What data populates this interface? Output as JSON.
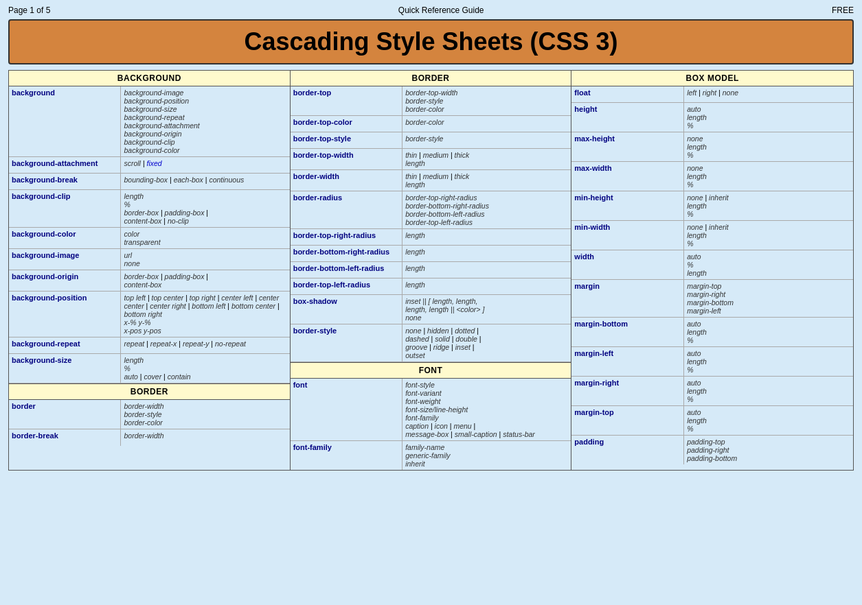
{
  "header": {
    "page_info": "Page 1 of 5",
    "title": "Quick Reference Guide",
    "price": "FREE"
  },
  "main_title": "Cascading Style Sheets (CSS 3)",
  "columns": [
    {
      "id": "background-col",
      "sections": [
        {
          "header": "BACKGROUND",
          "rows": [
            {
              "name": "background",
              "values": "background-image\nbackground-position\nbackground-size\nbackground-repeat\nbackground-attachment\nbackground-origin\nbackground-clip\nbackground-color"
            },
            {
              "name": "background-attachment",
              "values": "scroll | fixed"
            },
            {
              "name": "background-break",
              "values": "bounding-box | each-box | continuous"
            },
            {
              "name": "background-clip",
              "values": "length\n%\nborder-box | padding-box | content-box | no-clip"
            },
            {
              "name": "background-color",
              "values": "color\ntransparent"
            },
            {
              "name": "background-image",
              "values": "url\nnone"
            },
            {
              "name": "background-origin",
              "values": "border-box | padding-box | content-box"
            },
            {
              "name": "background-position",
              "values": "top left | top center | top right | center left | center center | center right | bottom left | bottom center | bottom right\nx-% y-%\nx-pos y-pos"
            },
            {
              "name": "background-repeat",
              "values": "repeat | repeat-x | repeat-y | no-repeat"
            },
            {
              "name": "background-size",
              "values": "length\n%\nauto | cover | contain"
            }
          ]
        },
        {
          "header": "BORDER",
          "rows": [
            {
              "name": "border",
              "values": "border-width\nborder-style\nborder-color"
            },
            {
              "name": "border-break",
              "values": "border-width"
            }
          ]
        }
      ]
    },
    {
      "id": "border-col",
      "sections": [
        {
          "header": "BORDER",
          "rows": [
            {
              "name": "border-top",
              "values": "border-top-width\nborder-style\nborder-color"
            },
            {
              "name": "border-top-color",
              "values": "border-color"
            },
            {
              "name": "border-top-style",
              "values": "border-style"
            },
            {
              "name": "border-top-width",
              "values": "thin | medium | thick\nlength"
            },
            {
              "name": "border-width",
              "values": "thin | medium | thick\nlength"
            },
            {
              "name": "border-radius",
              "values": "border-top-right-radius\nborder-bottom-right-radius\nborder-bottom-left-radius\nborder-top-left-radius"
            },
            {
              "name": "border-top-right-radius",
              "values": "length"
            },
            {
              "name": "border-bottom-right-radius",
              "values": "length"
            },
            {
              "name": "border-bottom-left-radius",
              "values": "length"
            },
            {
              "name": "border-top-left-radius",
              "values": "length"
            },
            {
              "name": "box-shadow",
              "values": "inset || [ length, length, length, length || <color> ]\nnone"
            },
            {
              "name": "border-style",
              "values": "none | hidden | dotted | dashed | solid | double | groove | ridge | inset | outset"
            }
          ]
        },
        {
          "header": "FONT",
          "rows": [
            {
              "name": "font",
              "values": "font-style\nfont-variant\nfont-weight\nfont-size/line-height\nfont-family\ncaption | icon | menu | message-box | small-caption | status-bar"
            },
            {
              "name": "font-family",
              "values": "family-name\ngeneric-family\ninherit"
            }
          ]
        }
      ]
    },
    {
      "id": "boxmodel-col",
      "sections": [
        {
          "header": "BOX MODEL",
          "rows": [
            {
              "name": "float",
              "values": "left | right | none"
            },
            {
              "name": "height",
              "values": "auto\nlength\n%"
            },
            {
              "name": "max-height",
              "values": "none\nlength\n%"
            },
            {
              "name": "max-width",
              "values": "none\nlength\n%"
            },
            {
              "name": "min-height",
              "values": "none | inherit\nlength\n%"
            },
            {
              "name": "min-width",
              "values": "none | inherit\nlength\n%"
            },
            {
              "name": "width",
              "values": "auto\n%\nlength"
            },
            {
              "name": "margin",
              "values": "margin-top\nmargin-right\nmargin-bottom\nmargin-left"
            },
            {
              "name": "margin-bottom",
              "values": "auto\nlength\n%"
            },
            {
              "name": "margin-left",
              "values": "auto\nlength\n%"
            },
            {
              "name": "margin-right",
              "values": "auto\nlength\n%"
            },
            {
              "name": "margin-top",
              "values": "auto\nlength\n%"
            },
            {
              "name": "padding",
              "values": "padding-top\npadding-right\npadding-bottom"
            }
          ]
        }
      ]
    }
  ]
}
